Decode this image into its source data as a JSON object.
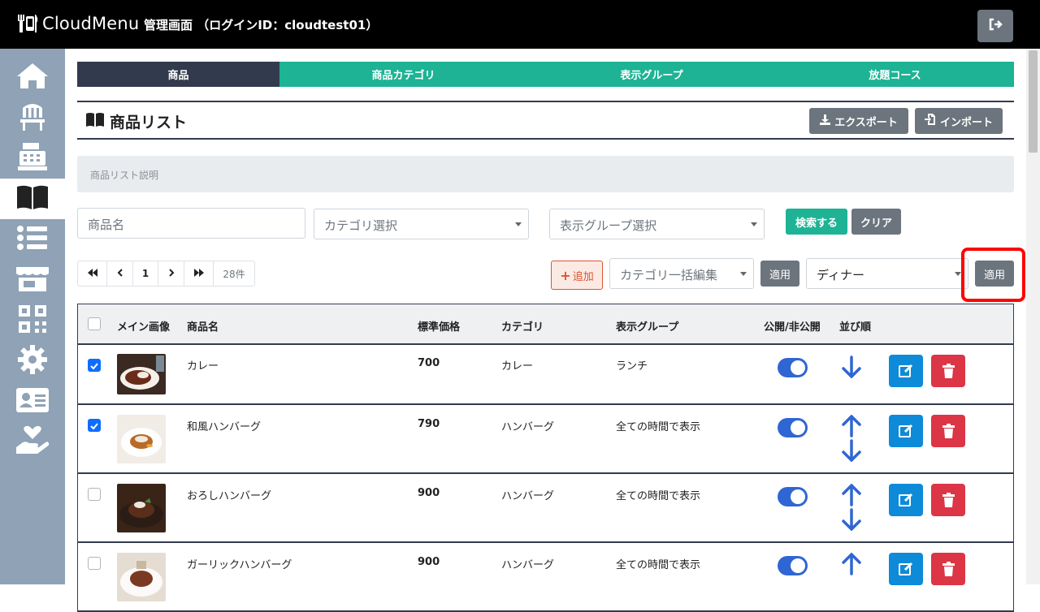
{
  "header": {
    "app_name": "CloudMenu",
    "admin_title": "管理画面 （ログインID：cloudtest01）"
  },
  "sidebar": {
    "items": [
      {
        "icon": "home-icon"
      },
      {
        "icon": "chair-icon"
      },
      {
        "icon": "register-icon"
      },
      {
        "icon": "book-icon",
        "active": true
      },
      {
        "icon": "list-icon"
      },
      {
        "icon": "store-icon"
      },
      {
        "icon": "qr-icon"
      },
      {
        "icon": "gear-icon"
      },
      {
        "icon": "id-card-icon"
      },
      {
        "icon": "hand-heart-icon"
      }
    ]
  },
  "tabs": [
    {
      "label": "商品",
      "active": true
    },
    {
      "label": "商品カテゴリ"
    },
    {
      "label": "表示グループ"
    },
    {
      "label": "放題コース"
    }
  ],
  "section": {
    "title": "商品リスト",
    "export_label": "エクスポート",
    "import_label": "インポート",
    "description": "商品リスト説明"
  },
  "search": {
    "name_placeholder": "商品名",
    "category_placeholder": "カテゴリ選択",
    "group_placeholder": "表示グループ選択",
    "search_label": "検索する",
    "clear_label": "クリア"
  },
  "pager": {
    "current_page": "1",
    "count": "28件"
  },
  "bulk": {
    "add_label": "追加",
    "category_bulk_placeholder": "カテゴリ一括編集",
    "apply_label_1": "適用",
    "group_value": "ディナー",
    "apply_label_2": "適用"
  },
  "table": {
    "headers": {
      "image": "メイン画像",
      "name": "商品名",
      "price": "標準価格",
      "category": "カテゴリ",
      "group": "表示グループ",
      "public": "公開/非公開",
      "order": "並び順"
    },
    "rows": [
      {
        "checked": true,
        "name": "カレー",
        "price": "700",
        "category": "カレー",
        "group": "ランチ",
        "image_color": "#5a2a1c"
      },
      {
        "checked": true,
        "name": "和風ハンバーグ",
        "price": "790",
        "category": "ハンバーグ",
        "group": "全ての時間で表示",
        "image_color": "#e8dfd3"
      },
      {
        "checked": false,
        "name": "おろしハンバーグ",
        "price": "900",
        "category": "ハンバーグ",
        "group": "全ての時間で表示",
        "image_color": "#4a2a1c"
      },
      {
        "checked": false,
        "name": "ガーリックハンバーグ",
        "price": "900",
        "category": "ハンバーグ",
        "group": "全ての時間で表示",
        "image_color": "#d9cfc4"
      }
    ]
  },
  "colors": {
    "accent": "#1db394",
    "dark": "#323b4d",
    "sidebar": "#8fa2b6",
    "primary": "#0d8bd9",
    "danger": "#dc3545",
    "highlight": "#ff0000"
  }
}
